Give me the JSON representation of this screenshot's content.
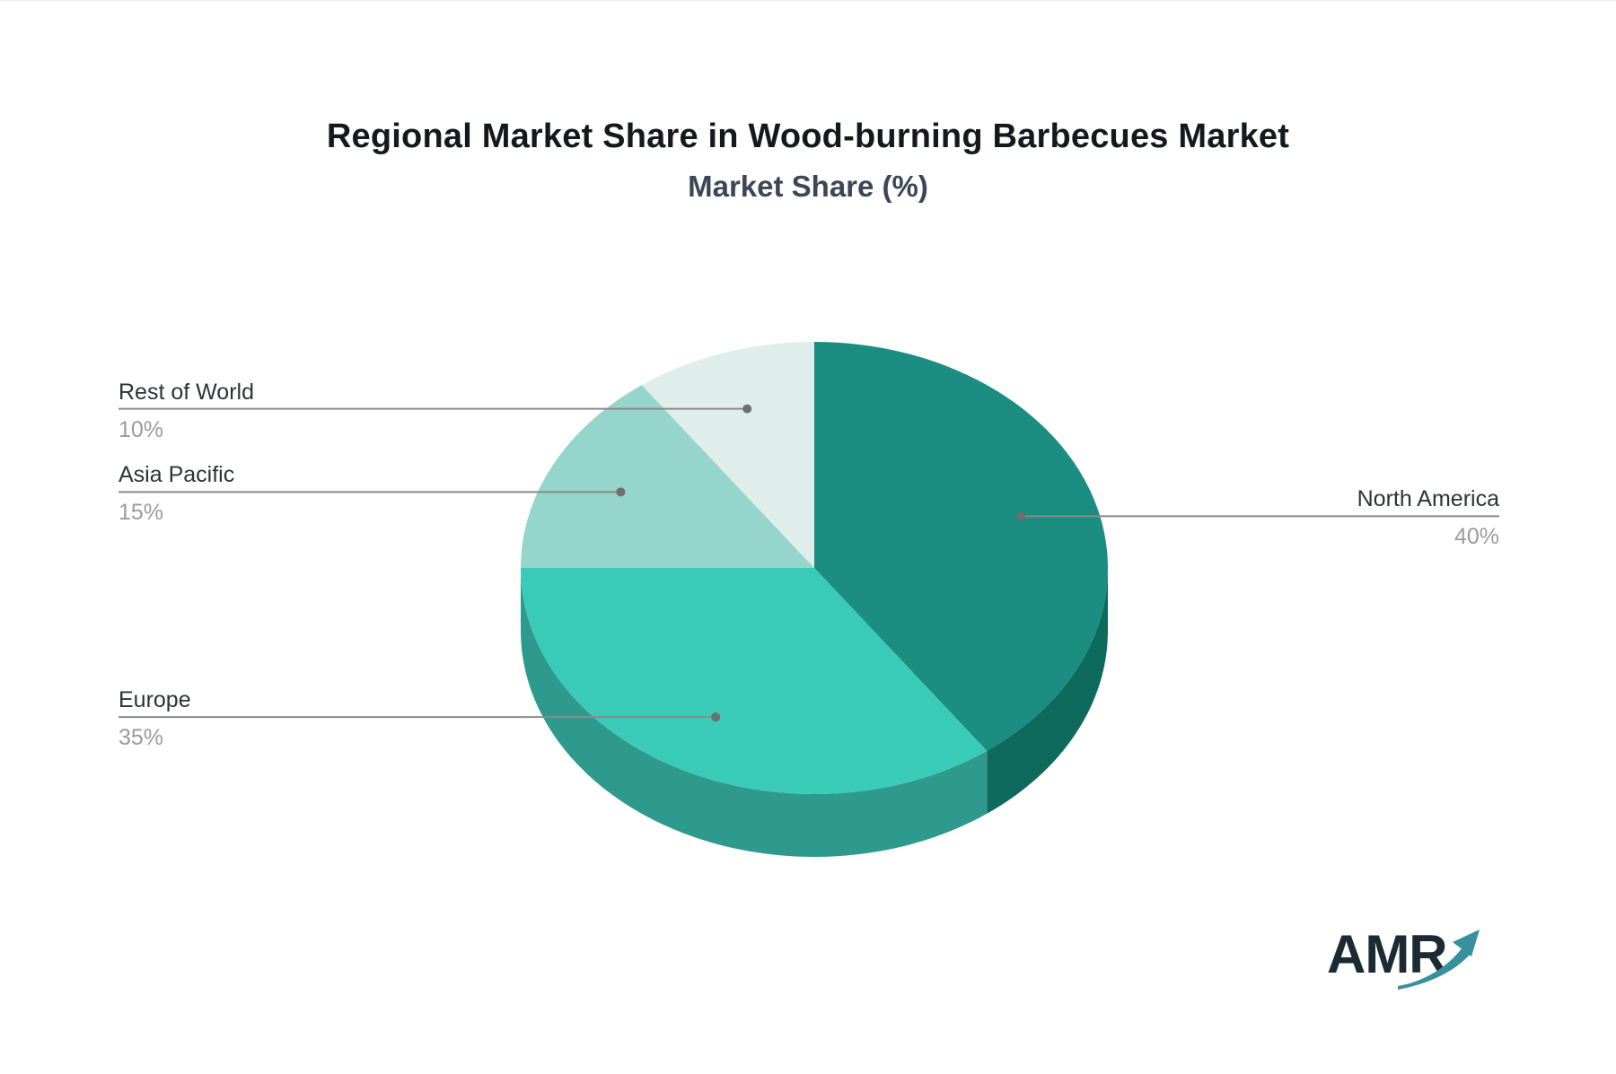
{
  "header": {
    "title": "Regional Market Share in Wood-burning Barbecues Market",
    "subtitle": "Market Share (%)"
  },
  "chart_data": {
    "type": "pie",
    "title": "Regional Market Share in Wood-burning Barbecues Market",
    "subtitle": "Market Share (%)",
    "unit": "%",
    "is_3d": true,
    "start_angle_deg": 0,
    "direction": "clockwise",
    "categories": [
      "North America",
      "Europe",
      "Asia Pacific",
      "Rest of World"
    ],
    "values": [
      40,
      35,
      15,
      10
    ],
    "value_labels": [
      "40%",
      "35%",
      "15%",
      "10%"
    ],
    "colors": [
      "#1b8e81",
      "#39cbb7",
      "#95d5cb",
      "#dfeeeb"
    ],
    "side_colors": [
      "#0f6a5e",
      "#2e9a8d",
      "#95d5cb",
      "#dfeeeb"
    ],
    "legend_position": "callout-labels"
  },
  "style": {
    "leader_line_color": "#8a8a8a",
    "leader_dot_color": "#6f6f6f",
    "label_name_color": "#2f3338",
    "label_value_color": "#9b9b9b"
  },
  "logo": {
    "text": "AMR",
    "text_color": "#1b2a33",
    "arrow_color": "#37909b"
  }
}
